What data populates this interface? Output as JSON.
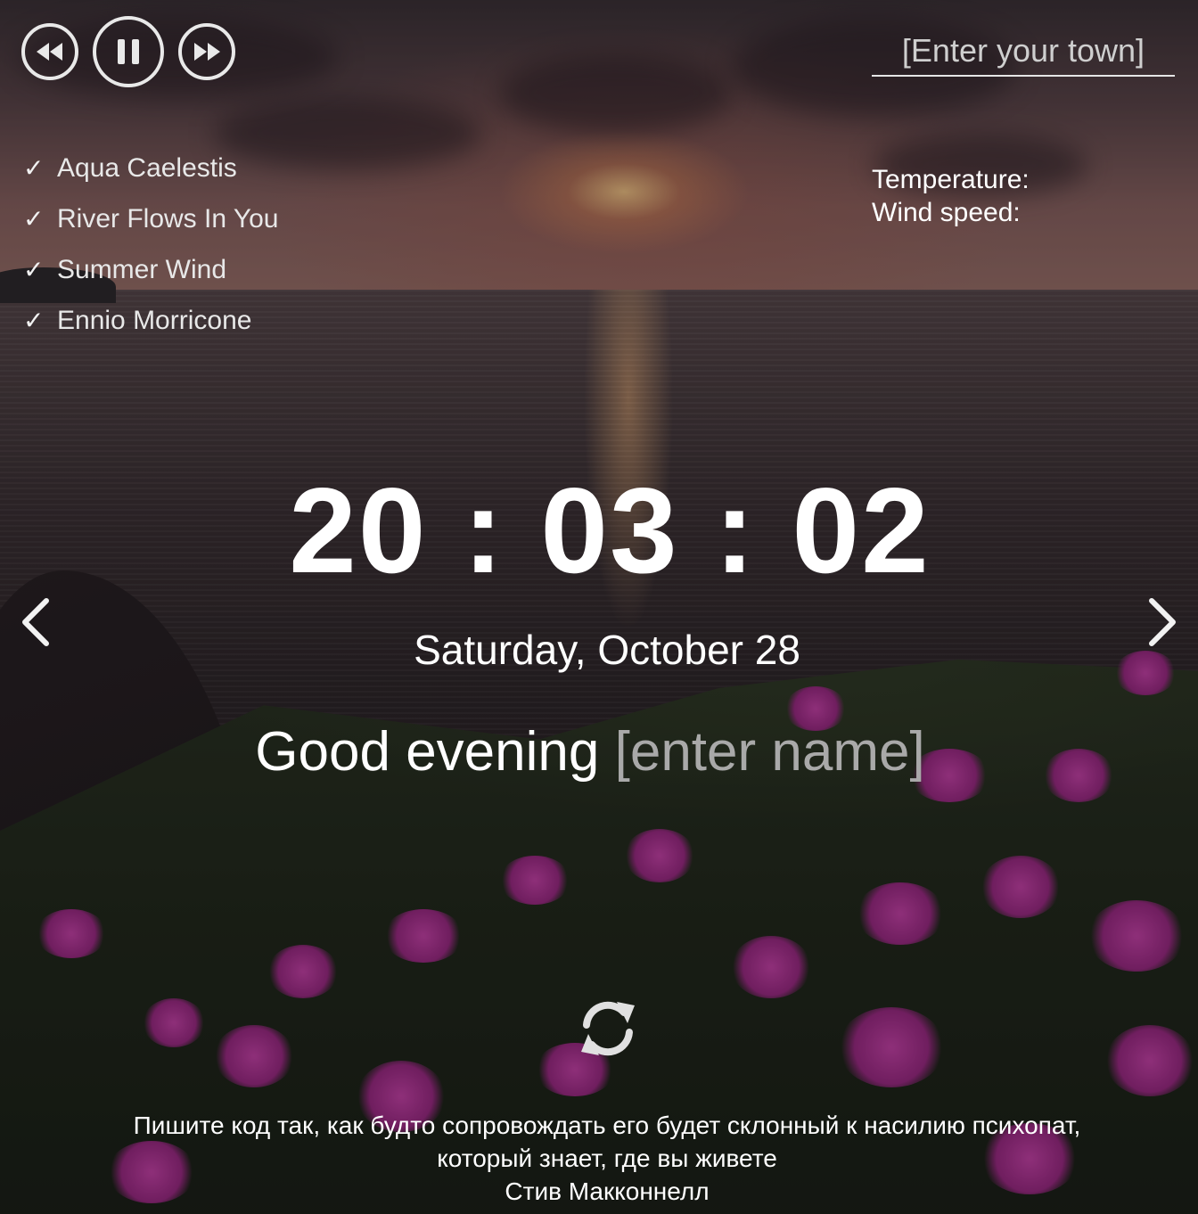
{
  "player": {
    "prev_icon": "rewind-icon",
    "play_icon": "pause-icon",
    "next_icon": "fast-forward-icon"
  },
  "playlist": [
    {
      "title": "Aqua Caelestis",
      "mark": "✓"
    },
    {
      "title": "River Flows In You",
      "mark": "✓"
    },
    {
      "title": "Summer Wind",
      "mark": "✓"
    },
    {
      "title": "Ennio Morricone",
      "mark": "✓"
    }
  ],
  "weather": {
    "city_placeholder": "[Enter your town]",
    "temperature_label": "Temperature:",
    "wind_label": "Wind speed:"
  },
  "clock": {
    "time": "20 : 03 : 02",
    "date": "Saturday, October 28"
  },
  "greeting": {
    "text": "Good evening ",
    "name_placeholder": "[enter name]"
  },
  "quote": {
    "line1": "Пишите код так, как будто сопровождать его будет склонный к насилию психопат,",
    "line2": "который знает, где вы живете",
    "author": "Стив Макконнелл"
  },
  "colors": {
    "text": "#ffffff",
    "muted": "#a9a9a9",
    "control": "#e9e9e9"
  }
}
